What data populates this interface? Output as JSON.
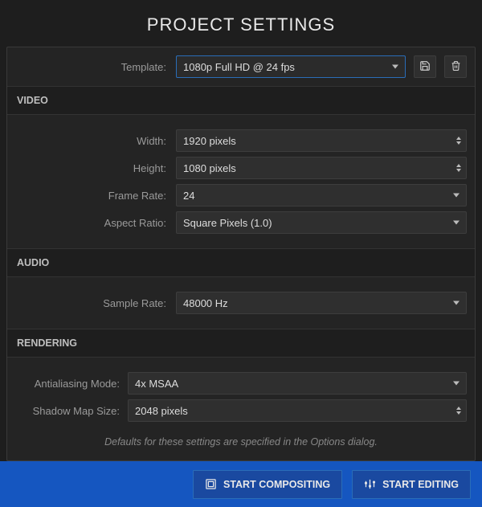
{
  "title": "PROJECT SETTINGS",
  "template": {
    "label": "Template:",
    "value": "1080p Full HD @ 24 fps"
  },
  "video": {
    "header": "VIDEO",
    "width_label": "Width:",
    "width_value": "1920 pixels",
    "height_label": "Height:",
    "height_value": "1080 pixels",
    "framerate_label": "Frame Rate:",
    "framerate_value": "24",
    "aspect_label": "Aspect Ratio:",
    "aspect_value": "Square Pixels (1.0)"
  },
  "audio": {
    "header": "AUDIO",
    "samplerate_label": "Sample Rate:",
    "samplerate_value": "48000 Hz"
  },
  "rendering": {
    "header": "RENDERING",
    "aa_label": "Antialiasing Mode:",
    "aa_value": "4x MSAA",
    "shadow_label": "Shadow Map Size:",
    "shadow_value": "2048 pixels",
    "note": "Defaults for these settings are specified in the Options dialog."
  },
  "footer": {
    "compositing": "START COMPOSITING",
    "editing": "START EDITING"
  }
}
